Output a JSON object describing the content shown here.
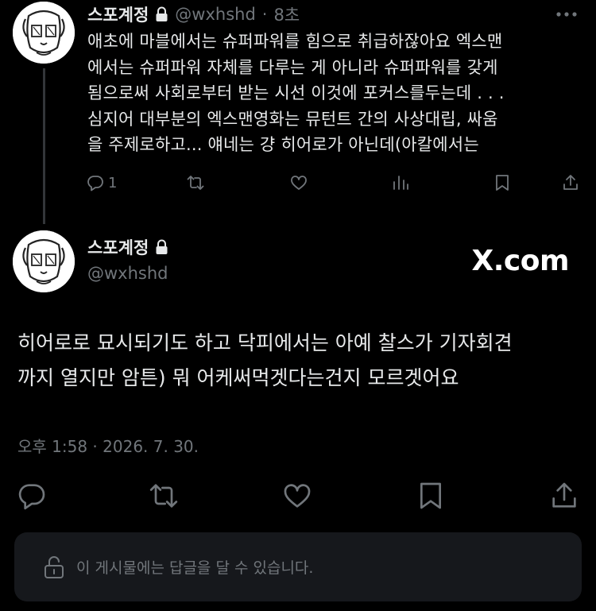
{
  "reply_tweet": {
    "display_name": "스포계정",
    "handle": "@wxhshd",
    "time_sep": "·",
    "time_ago": "8초",
    "lines": [
      "애초에 마블에서는 슈퍼파워를 힘으로 취급하잖아요 엑스맨",
      "에서는 슈퍼파워 자체를 다루는 게 아니라 슈퍼파워를 갖게",
      "됨으로써 사회로부터 받는 시선 이것에 포커스를두는데 . . .",
      "심지어 대부분의 엑스맨영화는 뮤턴트 간의 사상대립, 싸움",
      "을 주제로하고... 얘네는 걍 히어로가 아닌데(아칼에서는"
    ],
    "reply_count": "1",
    "icons": [
      "reply-icon",
      "retweet-icon",
      "like-icon",
      "views-icon",
      "bookmark-icon",
      "share-icon",
      "more-icon",
      "lock-icon"
    ]
  },
  "main_tweet": {
    "display_name": "스포계정",
    "handle": "@wxhshd",
    "watermark": "X.com",
    "lines": [
      "히어로로 묘시되기도 하고 닥피에서는 아예 찰스가 기자회견",
      "까지 열지만 암튼) 뭐 어케써먹겟다는건지 모르겟어요"
    ],
    "timestamp": "오후 1:58 · 2026. 7. 30."
  },
  "reply_bar": {
    "text": "이 게시물에는 답글을 달 수 있습니다.",
    "icon": "unlock-icon"
  },
  "colors": {
    "background": "#000000",
    "text": "#e7e9ea",
    "muted": "#71767b",
    "thread_line": "#333639",
    "reply_bar_bg": "#16181c"
  }
}
